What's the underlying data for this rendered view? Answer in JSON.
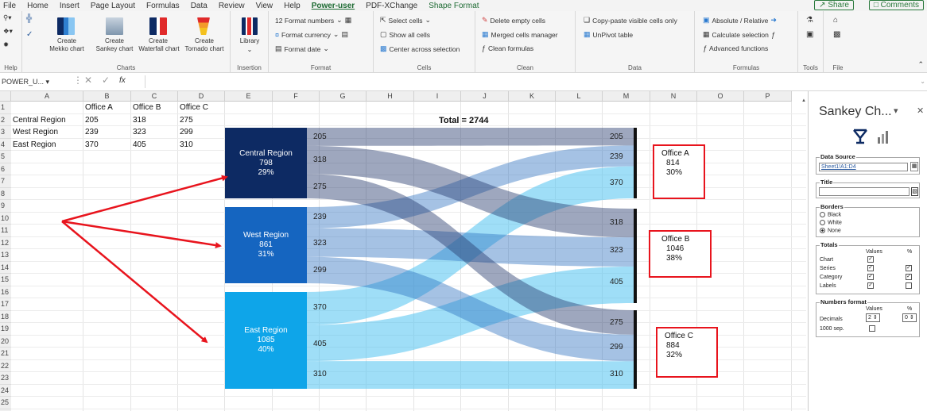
{
  "menu": {
    "tabs": [
      "File",
      "Home",
      "Insert",
      "Page Layout",
      "Formulas",
      "Data",
      "Review",
      "View",
      "Help",
      "Power-user",
      "PDF-XChange",
      "Shape Format"
    ],
    "active_tab": "Power-user",
    "share": "Share",
    "comments": "Comments"
  },
  "ribbon": {
    "help_group": "Help",
    "charts": {
      "label": "Charts",
      "buttons": [
        {
          "line1": "Create",
          "line2": "Mekko chart"
        },
        {
          "line1": "Create",
          "line2": "Sankey chart"
        },
        {
          "line1": "Create",
          "line2": "Waterfall chart"
        },
        {
          "line1": "Create",
          "line2": "Tornado chart"
        }
      ]
    },
    "insertion": {
      "label": "Insertion",
      "library": "Library"
    },
    "format": {
      "label": "Format",
      "format_numbers": "12 Format numbers",
      "format_currency": "Format currency",
      "format_date": "Format date"
    },
    "cells": {
      "label": "Cells",
      "select_cells": "Select cells",
      "show_all_cells": "Show all cells",
      "center_across": "Center across selection"
    },
    "clean": {
      "label": "Clean",
      "delete_empty": "Delete empty cells",
      "merged_manager": "Merged cells manager",
      "clean_formulas": "Clean formulas"
    },
    "data": {
      "label": "Data",
      "copy_paste": "Copy-paste visible cells only",
      "unpivot": "UnPivot table"
    },
    "formulas": {
      "label": "Formulas",
      "absolute": "Absolute / Relative",
      "calc_selection": "Calculate selection",
      "advanced": "Advanced functions"
    },
    "tools": {
      "label": "Tools"
    },
    "file": {
      "label": "File"
    }
  },
  "formula_bar": {
    "name_box": "POWER_U...",
    "fx": "fx",
    "content": ""
  },
  "sheet": {
    "columns": [
      "A",
      "B",
      "C",
      "D",
      "E",
      "F",
      "G",
      "H",
      "I",
      "J",
      "K",
      "L",
      "M",
      "N",
      "O",
      "P"
    ],
    "rows": [
      "1",
      "2",
      "3",
      "4",
      "5",
      "6",
      "7",
      "8",
      "9",
      "10",
      "11",
      "12",
      "13",
      "14",
      "15",
      "16",
      "17",
      "18",
      "19",
      "20",
      "21",
      "22",
      "23",
      "24",
      "25",
      "26"
    ],
    "cells": {
      "B1": "Office A",
      "C1": "Office B",
      "D1": "Office C",
      "A2": "Central Region",
      "B2": "205",
      "C2": "318",
      "D2": "275",
      "A3": "West Region",
      "B3": "239",
      "C3": "323",
      "D3": "299",
      "A4": "East Region",
      "B4": "370",
      "C4": "405",
      "D4": "310"
    }
  },
  "chart_data": {
    "type": "sankey",
    "title": "Total = 2744",
    "sources": [
      {
        "name": "Central Region",
        "total": "798",
        "pct": "29%",
        "color": "#0d2a63"
      },
      {
        "name": "West Region",
        "total": "861",
        "pct": "31%",
        "color": "#1565c0"
      },
      {
        "name": "East Region",
        "total": "1085",
        "pct": "40%",
        "color": "#0ea5e9"
      }
    ],
    "targets": [
      {
        "name": "Office A",
        "total": "814",
        "pct": "30%"
      },
      {
        "name": "Office B",
        "total": "1046",
        "pct": "38%"
      },
      {
        "name": "Office C",
        "total": "884",
        "pct": "32%"
      }
    ],
    "flows": [
      {
        "source": "Central Region",
        "target": "Office A",
        "value": 205
      },
      {
        "source": "Central Region",
        "target": "Office B",
        "value": 318
      },
      {
        "source": "Central Region",
        "target": "Office C",
        "value": 275
      },
      {
        "source": "West Region",
        "target": "Office A",
        "value": 239
      },
      {
        "source": "West Region",
        "target": "Office B",
        "value": 323
      },
      {
        "source": "West Region",
        "target": "Office C",
        "value": 299
      },
      {
        "source": "East Region",
        "target": "Office A",
        "value": 370
      },
      {
        "source": "East Region",
        "target": "Office B",
        "value": 405
      },
      {
        "source": "East Region",
        "target": "Office C",
        "value": 310
      }
    ],
    "target_values_display": [
      "205",
      "239",
      "370",
      "318",
      "323",
      "405",
      "275",
      "299",
      "310"
    ]
  },
  "pane": {
    "title": "Sankey Ch...",
    "data_source_label": "Data Source",
    "data_source_value": "Sheet1!A1:D4",
    "title_label": "Title",
    "title_value": "",
    "borders_label": "Borders",
    "borders_options": [
      "Black",
      "White",
      "None"
    ],
    "borders_selected": "None",
    "totals_label": "Totals",
    "totals_col_values": "Values",
    "totals_col_pct": "%",
    "totals_rows": [
      "Chart",
      "Series",
      "Category",
      "Labels"
    ],
    "numbers_format_label": "Numbers format",
    "nf_values": "Values",
    "nf_pct": "%",
    "decimals_label": "Decimals",
    "decimals_value": "2",
    "decimals_pct_value": "0",
    "thousand_sep_label": "1000 sep."
  }
}
